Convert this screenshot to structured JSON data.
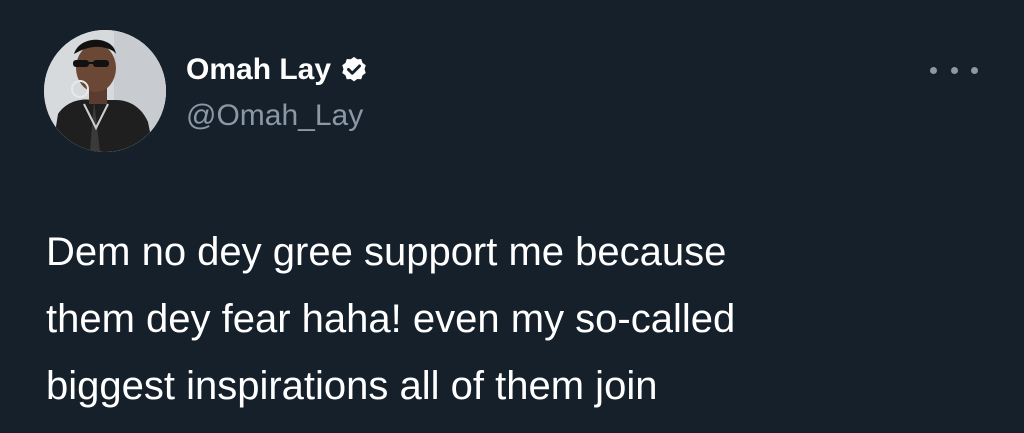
{
  "tweet": {
    "author": {
      "display_name": "Omah Lay",
      "handle": "@Omah_Lay",
      "verified": true,
      "avatar_icon": "profile-photo"
    },
    "more_icon": "more-options-icon",
    "text_lines": [
      "Dem no dey gree support me because",
      "them dey fear haha! even my so-called",
      "biggest inspirations all of them join"
    ]
  },
  "colors": {
    "background": "#15202b",
    "primary_text": "#ffffff",
    "secondary_text": "#8b98a5",
    "verified_badge": "#ffffff"
  }
}
